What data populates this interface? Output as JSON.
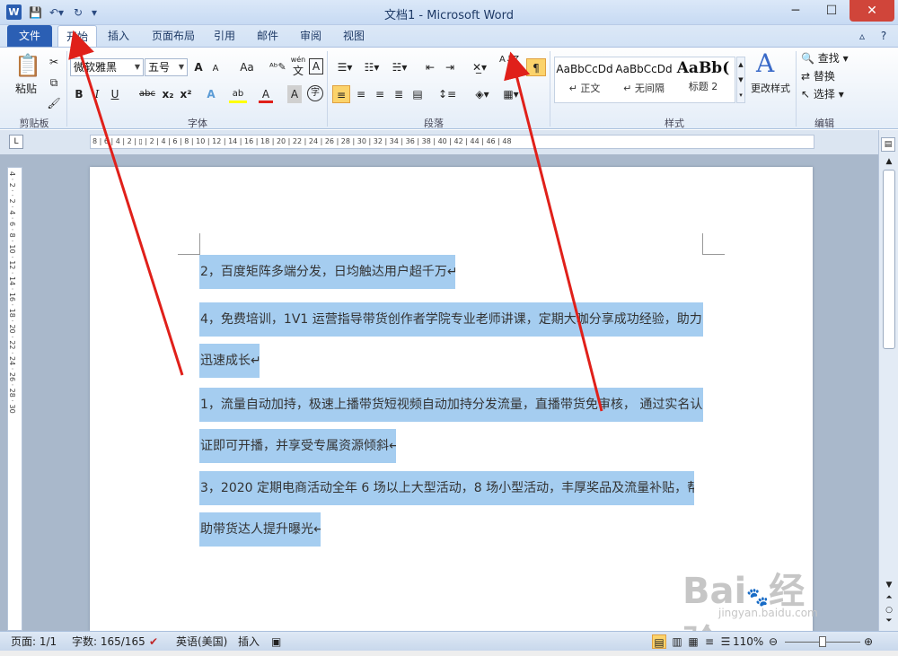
{
  "title_bar": {
    "title": "文档1 - Microsoft Word",
    "app_icon_letter": "W",
    "buttons": [
      "─",
      "☐",
      "✕"
    ]
  },
  "tabs": [
    {
      "label": "文件",
      "active": false
    },
    {
      "label": "开始",
      "active": true
    },
    {
      "label": "插入",
      "active": false
    },
    {
      "label": "页面布局",
      "active": false
    },
    {
      "label": "引用",
      "active": false
    },
    {
      "label": "邮件",
      "active": false
    },
    {
      "label": "审阅",
      "active": false
    },
    {
      "label": "视图",
      "active": false
    }
  ],
  "ribbon": {
    "clipboard": {
      "group_label": "剪贴板",
      "paste_label": "粘贴"
    },
    "font": {
      "group_label": "字体",
      "font_name": "微软雅黑",
      "font_size": "五号",
      "grow": "A",
      "shrink": "A",
      "case": "Aa",
      "bold": "B",
      "italic": "I",
      "underline": "U",
      "strike": "abc",
      "sub": "x₂",
      "sup": "x²",
      "effects": "A",
      "highlight": "ab",
      "color": "A",
      "shade": "A",
      "encircle": "字",
      "phonetic": "wén",
      "phonetic_base": "文",
      "border": "A"
    },
    "paragraph": {
      "group_label": "段落",
      "sort_label": "A↓Z"
    },
    "styles": {
      "group_label": "样式",
      "items": [
        {
          "sample": "AaBbCcDd",
          "name": "↵ 正文"
        },
        {
          "sample": "AaBbCcDd",
          "name": "↵ 无间隔"
        },
        {
          "sample": "AaBb(",
          "name": "标题 2"
        }
      ],
      "change_styles": "更改样式"
    },
    "editing": {
      "group_label": "编辑",
      "find": "查找",
      "replace": "替换",
      "select": "选择"
    }
  },
  "ruler_text": "8 | 6 | 4 | 2 | ▯ | 2 | 4 | 6 | 8 | 10 | 12 | 14 | 16 | 18 | 20 | 22 | 24 | 26 | 28 | 30 | 32 | 34 | 36 | 38 | 40 | 42 | 44 | 46 | 48",
  "vruler_text": "4 · 2 · · 2 · 4 · 6 · 8 · 10 · 12 · 14 · 16 · 18 · 20 · 22 · 24 · 26 · 28 · 30",
  "document": {
    "lines": [
      "2，百度矩阵多端分发，日均触达用户超千万↵",
      "4，免费培训，1V1 运营指导带货创作者学院专业老师讲课，定期大咖分享成功经验，助力",
      "迅速成长↵",
      "1，流量自动加持，极速上播带货短视频自动加持分发流量，直播带货免审核， 通过实名认",
      "证即可开播，并享受专属资源倾斜↵",
      "3，2020 定期电商活动全年 6 场以上大型活动，8 场小型活动，丰厚奖品及流量补贴，帮",
      "助带货达人提升曝光↵"
    ]
  },
  "status_bar": {
    "page": "页面: 1/1",
    "words": "字数: 165/165",
    "language": "英语(美国)",
    "mode": "插入",
    "zoom": "110%",
    "zoom_minus": "⊖",
    "zoom_plus": "⊕"
  },
  "watermark": {
    "text": "Bai",
    "sub": "jingyan.baidu.com",
    "brand": "经验"
  },
  "colors": {
    "selection": "#a5cdf0",
    "file_tab": "#2b5fb4",
    "arrow": "#e0201a"
  }
}
